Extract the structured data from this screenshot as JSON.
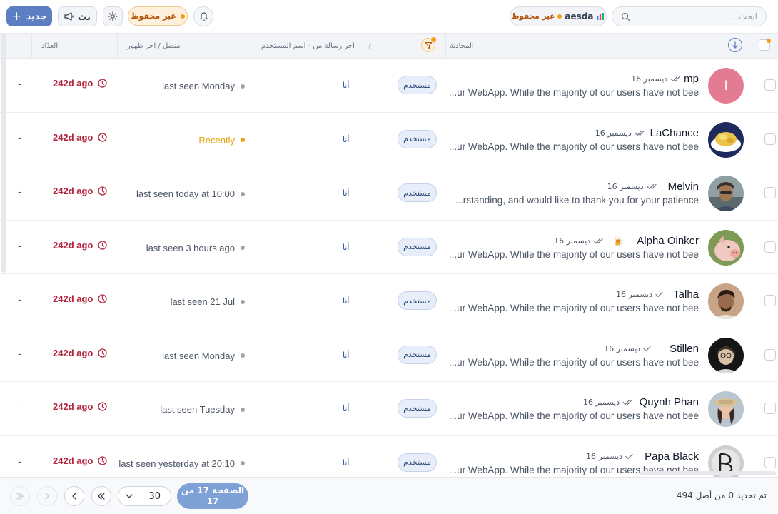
{
  "toolbar": {
    "new_label": "جديد",
    "broadcast_label": "بث",
    "unsaved_label": "غير محفوظ",
    "account_name": "aesda",
    "account_status": "غير محفوظ",
    "search_placeholder": "ابحث...",
    "colors": {
      "primary": "#5b7fc2",
      "warning": "#f59e0b",
      "danger": "#b4233c"
    }
  },
  "table": {
    "headers": {
      "conversation": "المحادثة",
      "last_message_from": "اخر رسالة من - اسم المستخدم",
      "online_last_seen": "متصل / اخر ظهور",
      "counter": "العدّاد",
      "empty_col": "ع"
    },
    "rows": [
      {
        "name": "mp",
        "date": "16 ديسمبر",
        "preview": "...ur WebApp. While the majority of our users have not bee",
        "tag": "مستخدم",
        "from": "أنا",
        "seen": "last seen Monday",
        "seen_state": "offline",
        "ago": "242d ago",
        "counter": "-",
        "check": "double",
        "avatar": "initial",
        "initial": "ا"
      },
      {
        "name": "LaChance",
        "date": "16 ديسمبر",
        "preview": "...ur WebApp. While the majority of our users have not bee",
        "tag": "مستخدم",
        "from": "أنا",
        "seen": "Recently",
        "seen_state": "recent",
        "ago": "242d ago",
        "counter": "-",
        "check": "double",
        "avatar": "food"
      },
      {
        "name": "Melvin",
        "date": "16 ديسمبر",
        "preview": "...rstanding, and would like to thank you for your patience",
        "tag": "مستخدم",
        "from": "أنا",
        "seen": "last seen today at 10:00",
        "seen_state": "offline",
        "ago": "242d ago",
        "counter": "-",
        "check": "double",
        "avatar": "person1"
      },
      {
        "name": "Alpha Oinker",
        "date": "16 ديسمبر",
        "preview": "...ur WebApp. While the majority of our users have not bee",
        "tag": "مستخدم",
        "from": "أنا",
        "seen": "last seen 3 hours ago",
        "seen_state": "offline",
        "ago": "242d ago",
        "counter": "-",
        "check": "double",
        "avatar": "pig",
        "badge": "🍺"
      },
      {
        "name": "Talha",
        "date": "16 ديسمبر",
        "preview": "...ur WebApp. While the majority of our users have not bee",
        "tag": "مستخدم",
        "from": "أنا",
        "seen": "last seen 21 Jul",
        "seen_state": "offline",
        "ago": "242d ago",
        "counter": "-",
        "check": "single",
        "avatar": "person2"
      },
      {
        "name": "Stillen",
        "date": "16 ديسمبر",
        "preview": "...ur WebApp. While the majority of our users have not bee",
        "tag": "مستخدم",
        "from": "أنا",
        "seen": "last seen Monday",
        "seen_state": "offline",
        "ago": "242d ago",
        "counter": "-",
        "check": "single",
        "avatar": "person3"
      },
      {
        "name": "Quynh Phan",
        "date": "16 ديسمبر",
        "preview": "...ur WebApp. While the majority of our users have not bee",
        "tag": "مستخدم",
        "from": "أنا",
        "seen": "last seen Tuesday",
        "seen_state": "offline",
        "ago": "242d ago",
        "counter": "-",
        "check": "double",
        "avatar": "person4"
      },
      {
        "name": "Papa Black",
        "date": "16 ديسمبر",
        "preview": "...ur WebApp. While the majority of our users have not bee",
        "tag": "مستخدم",
        "from": "أنا",
        "seen": "last seen yesterday at 20:10",
        "seen_state": "offline",
        "ago": "242d ago",
        "counter": "-",
        "check": "single",
        "avatar": "logo"
      }
    ]
  },
  "footer": {
    "page_size": "30",
    "page_indicator": "الصفحة 17 من 17",
    "selection_info": "تم تحديد 0 من أصل 494"
  }
}
